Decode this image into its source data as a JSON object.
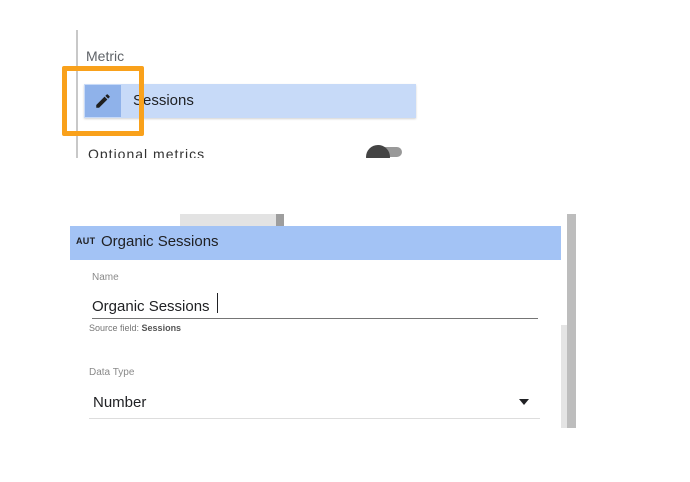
{
  "metric_panel": {
    "section_label": "Metric",
    "chip_label": "Sessions",
    "cut_off_text": "Optional metrics"
  },
  "field_editor": {
    "type_badge": "AUT",
    "title": "Organic Sessions",
    "name_label": "Name",
    "name_value": "Organic Sessions",
    "source_field_prefix": "Source field:",
    "source_field_value": "Sessions",
    "data_type_label": "Data Type",
    "data_type_value": "Number"
  },
  "colors": {
    "highlight": "#f9a11b",
    "chip_bg": "#c7daf8",
    "header_bg": "#a3c3f5"
  },
  "icons": [
    "pencil-icon",
    "dropdown-arrow-icon"
  ]
}
